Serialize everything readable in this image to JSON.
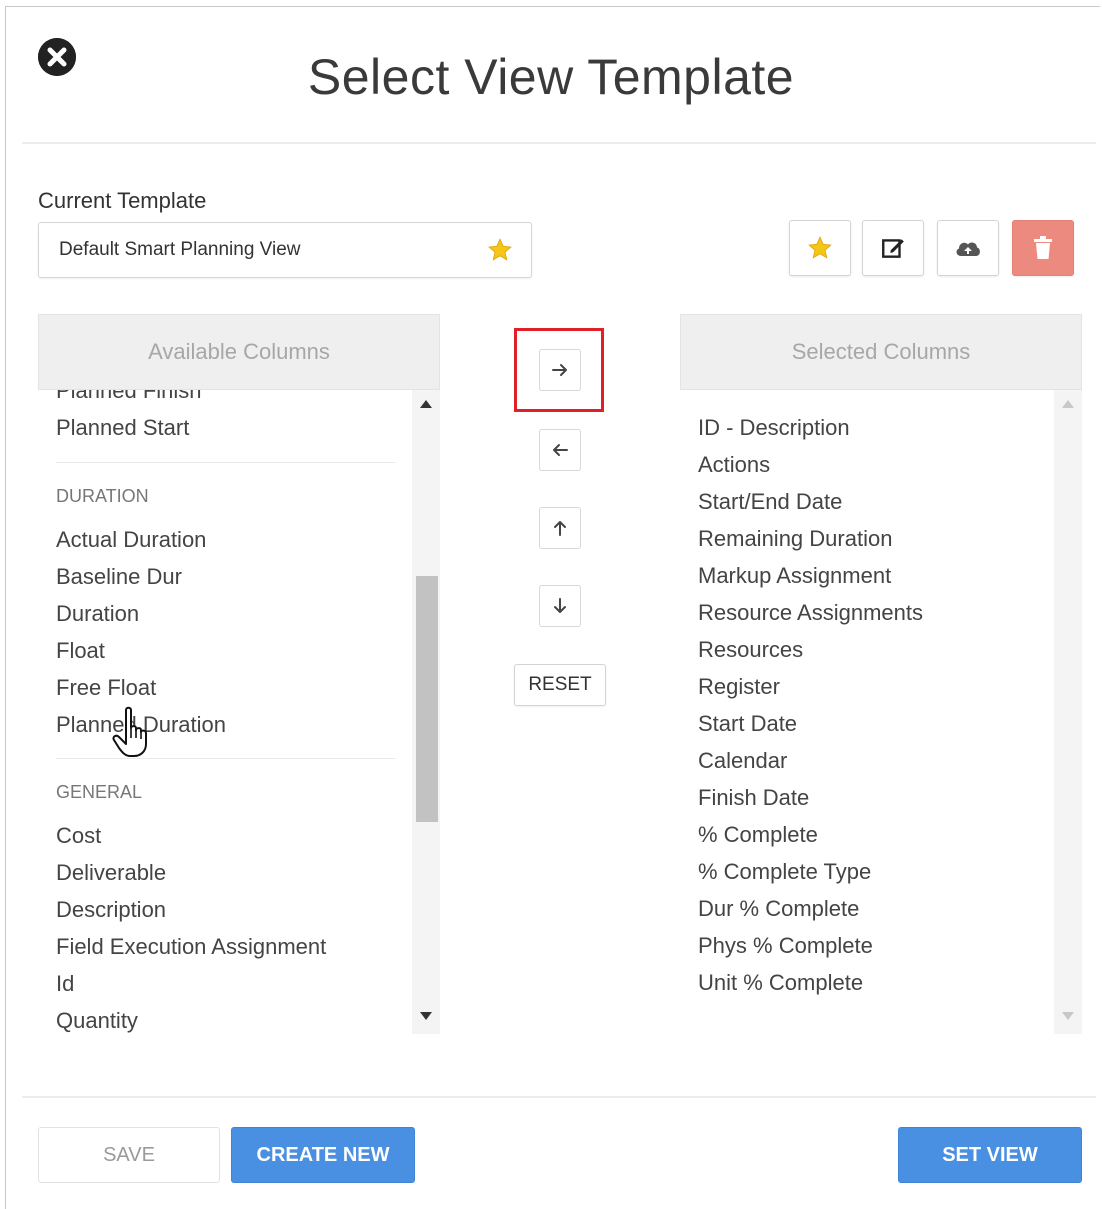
{
  "dialog": {
    "title": "Select View Template"
  },
  "current_template": {
    "label": "Current Template",
    "value": "Default Smart Planning View"
  },
  "toolbar": {
    "favorite_icon": "star-icon",
    "edit_icon": "edit-icon",
    "cloud_icon": "cloud-upload-icon",
    "delete_icon": "trash-icon"
  },
  "available_columns": {
    "header": "Available Columns",
    "partial_item": "Planned Finish",
    "items_before": [
      "Planned Start"
    ],
    "groups": [
      {
        "name": "DURATION",
        "items": [
          "Actual Duration",
          "Baseline Dur",
          "Duration",
          "Float",
          "Free Float",
          "Planned Duration"
        ]
      },
      {
        "name": "GENERAL",
        "items": [
          "Cost",
          "Deliverable",
          "Description",
          "Field Execution Assignment",
          "Id",
          "Quantity"
        ]
      }
    ]
  },
  "selected_columns": {
    "header": "Selected Columns",
    "items": [
      "ID - Description",
      "Actions",
      "Start/End Date",
      "Remaining Duration",
      "Markup Assignment",
      "Resource Assignments",
      "Resources",
      "Register",
      "Start Date",
      "Calendar",
      "Finish Date",
      "% Complete",
      "% Complete Type",
      "Dur % Complete",
      "Phys % Complete",
      "Unit % Complete"
    ]
  },
  "move_controls": {
    "reset_label": "RESET"
  },
  "footer": {
    "save_label": "SAVE",
    "create_new_label": "CREATE NEW",
    "set_view_label": "SET VIEW"
  },
  "colors": {
    "primary": "#4a90e2",
    "delete": "#ec8a7f",
    "highlight": "#e02029",
    "star": "#f5c518"
  }
}
